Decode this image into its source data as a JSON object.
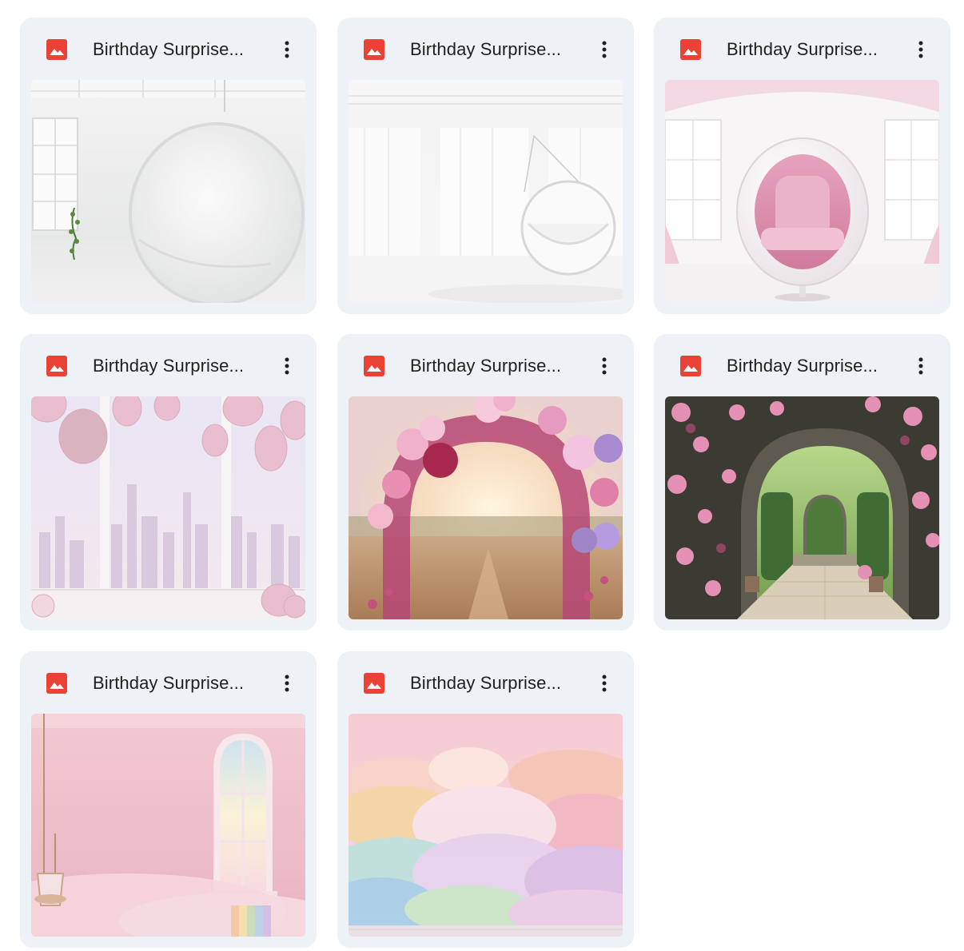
{
  "files": [
    {
      "title": "Birthday Surprise...",
      "type_icon": "image-file-icon",
      "thumbnail": "white room with round hanging swing and plant"
    },
    {
      "title": "Birthday Surprise...",
      "type_icon": "image-file-icon",
      "thumbnail": "white room with hanging swing chair and curtains"
    },
    {
      "title": "Birthday Surprise...",
      "type_icon": "image-file-icon",
      "thumbnail": "white egg chair with pink cushion"
    },
    {
      "title": "Birthday Surprise...",
      "type_icon": "image-file-icon",
      "thumbnail": "pink balloons in front of city window"
    },
    {
      "title": "Birthday Surprise...",
      "type_icon": "image-file-icon",
      "thumbnail": "balloon and flower arch in meadow"
    },
    {
      "title": "Birthday Surprise...",
      "type_icon": "image-file-icon",
      "thumbnail": "stone archway covered with pink roses"
    },
    {
      "title": "Birthday Surprise...",
      "type_icon": "image-file-icon",
      "thumbnail": "pink room with arched window and swing"
    },
    {
      "title": "Birthday Surprise...",
      "type_icon": "image-file-icon",
      "thumbnail": "pastel rainbow clouds"
    }
  ],
  "colors": {
    "card_bg": "#eef1f6",
    "icon_red": "#ea4335",
    "title_text": "#1f1f1f",
    "menu_dots": "#1f1f1f"
  }
}
